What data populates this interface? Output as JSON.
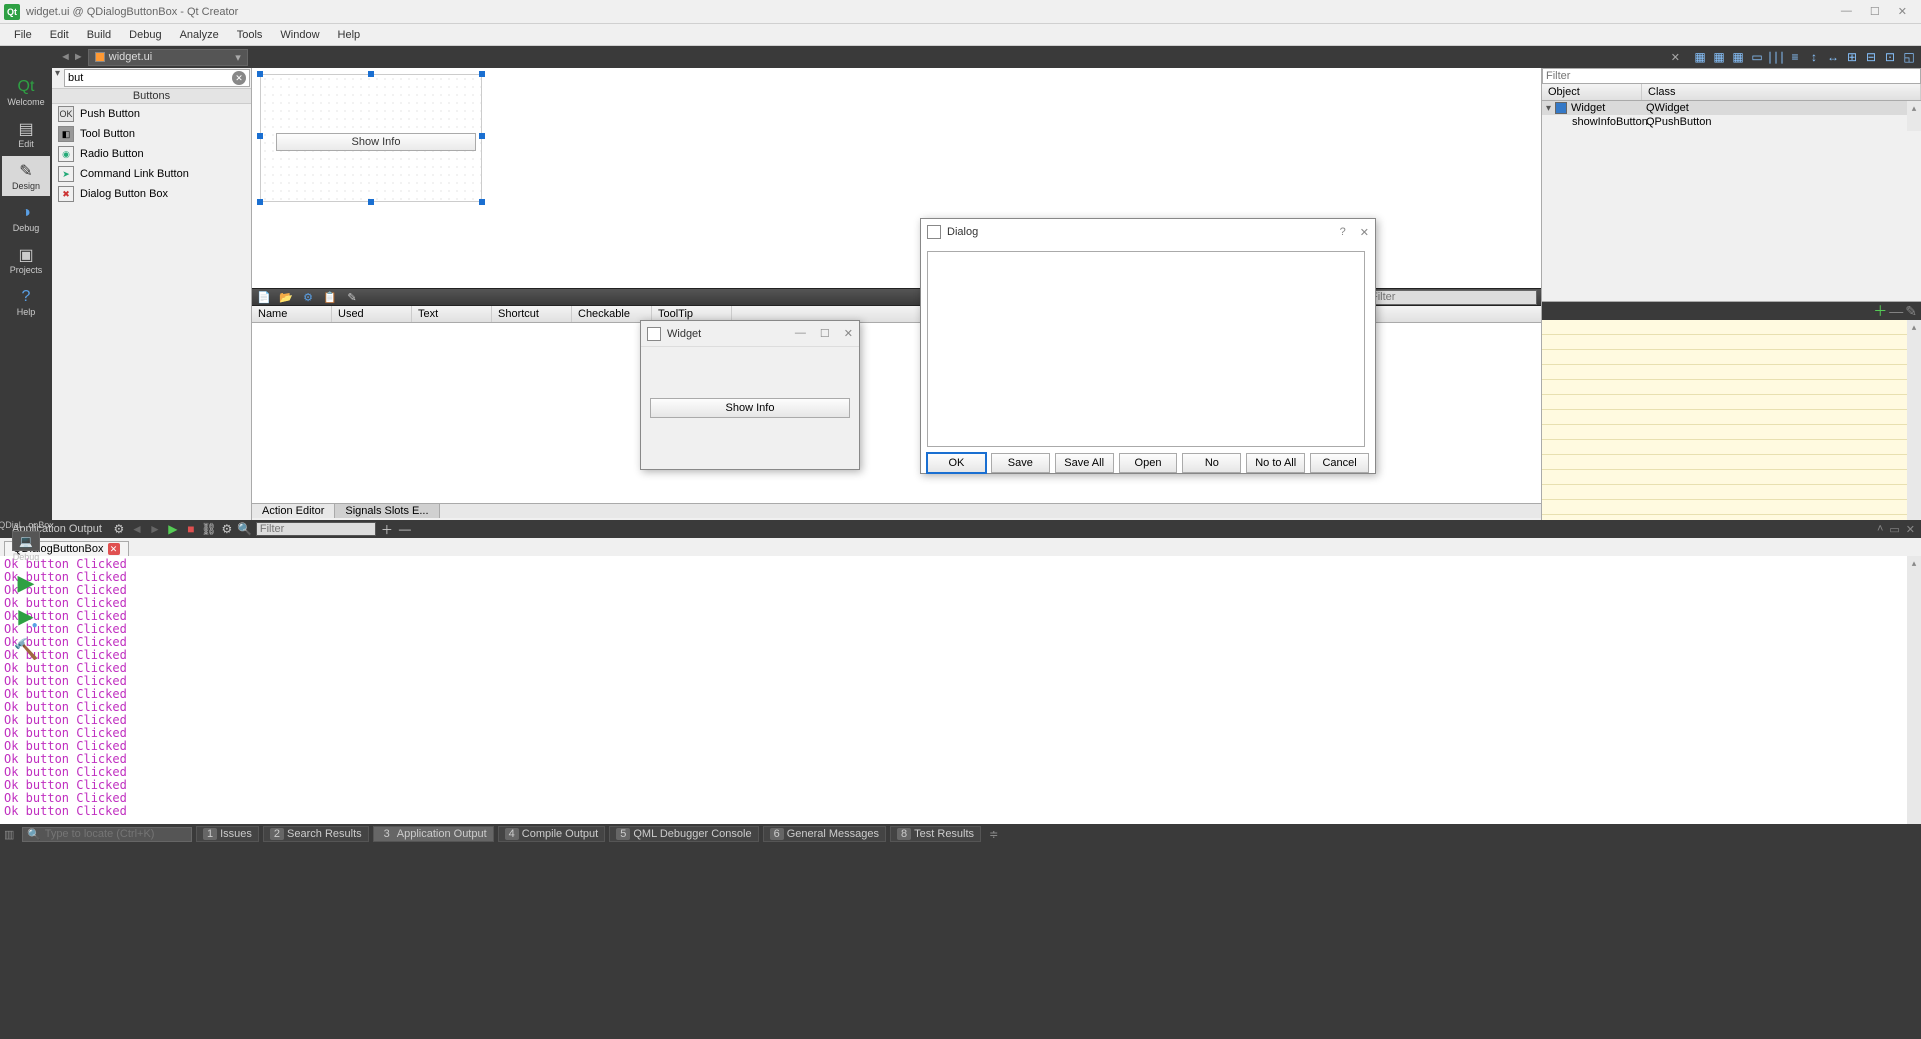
{
  "window": {
    "title": "widget.ui @ QDialogButtonBox - Qt Creator"
  },
  "menubar": [
    "File",
    "Edit",
    "Build",
    "Debug",
    "Analyze",
    "Tools",
    "Window",
    "Help"
  ],
  "file_tab": "widget.ui",
  "modes": [
    {
      "label": "Welcome",
      "icon": "Qt"
    },
    {
      "label": "Edit",
      "icon": "✎"
    },
    {
      "label": "Design",
      "icon": "✐"
    },
    {
      "label": "Debug",
      "icon": "🐞"
    },
    {
      "label": "Projects",
      "icon": "📁"
    },
    {
      "label": "Help",
      "icon": "?"
    }
  ],
  "kit": {
    "label": "QDial...onBox",
    "config": "Debug"
  },
  "widgetbox": {
    "filter_value": "but",
    "category": "Buttons",
    "items": [
      {
        "label": "Push Button",
        "icon": "OK"
      },
      {
        "label": "Tool Button",
        "icon": "◧"
      },
      {
        "label": "Radio Button",
        "icon": "◉"
      },
      {
        "label": "Command Link Button",
        "icon": "➤"
      },
      {
        "label": "Dialog Button Box",
        "icon": "✖"
      }
    ]
  },
  "form_button_text": "Show Info",
  "inspector": {
    "filter_placeholder": "Filter",
    "col_object": "Object",
    "col_class": "Class",
    "rows": [
      {
        "object": "Widget",
        "class": "QWidget"
      },
      {
        "object": "showInfoButton",
        "class": "QPushButton"
      }
    ]
  },
  "action_editor": {
    "filter_placeholder": "Filter",
    "columns": [
      "Name",
      "Used",
      "Text",
      "Shortcut",
      "Checkable",
      "ToolTip"
    ],
    "tabs": {
      "active": "Action Editor",
      "other": "Signals Slots E..."
    }
  },
  "app_output": {
    "title": "Application Output",
    "filter_placeholder": "Filter",
    "tab": "QDialogButtonBox",
    "line": "Ok button Clicked",
    "line_count": 20
  },
  "status_panels": [
    {
      "num": "1",
      "label": "Issues"
    },
    {
      "num": "2",
      "label": "Search Results"
    },
    {
      "num": "3",
      "label": "Application Output"
    },
    {
      "num": "4",
      "label": "Compile Output"
    },
    {
      "num": "5",
      "label": "QML Debugger Console"
    },
    {
      "num": "6",
      "label": "General Messages"
    },
    {
      "num": "8",
      "label": "Test Results"
    }
  ],
  "locator_placeholder": "Type to locate (Ctrl+K)",
  "widget_window": {
    "title": "Widget",
    "button": "Show Info"
  },
  "dialog_window": {
    "title": "Dialog",
    "buttons": [
      "OK",
      "Save",
      "Save All",
      "Open",
      "No",
      "No to All",
      "Cancel"
    ]
  }
}
